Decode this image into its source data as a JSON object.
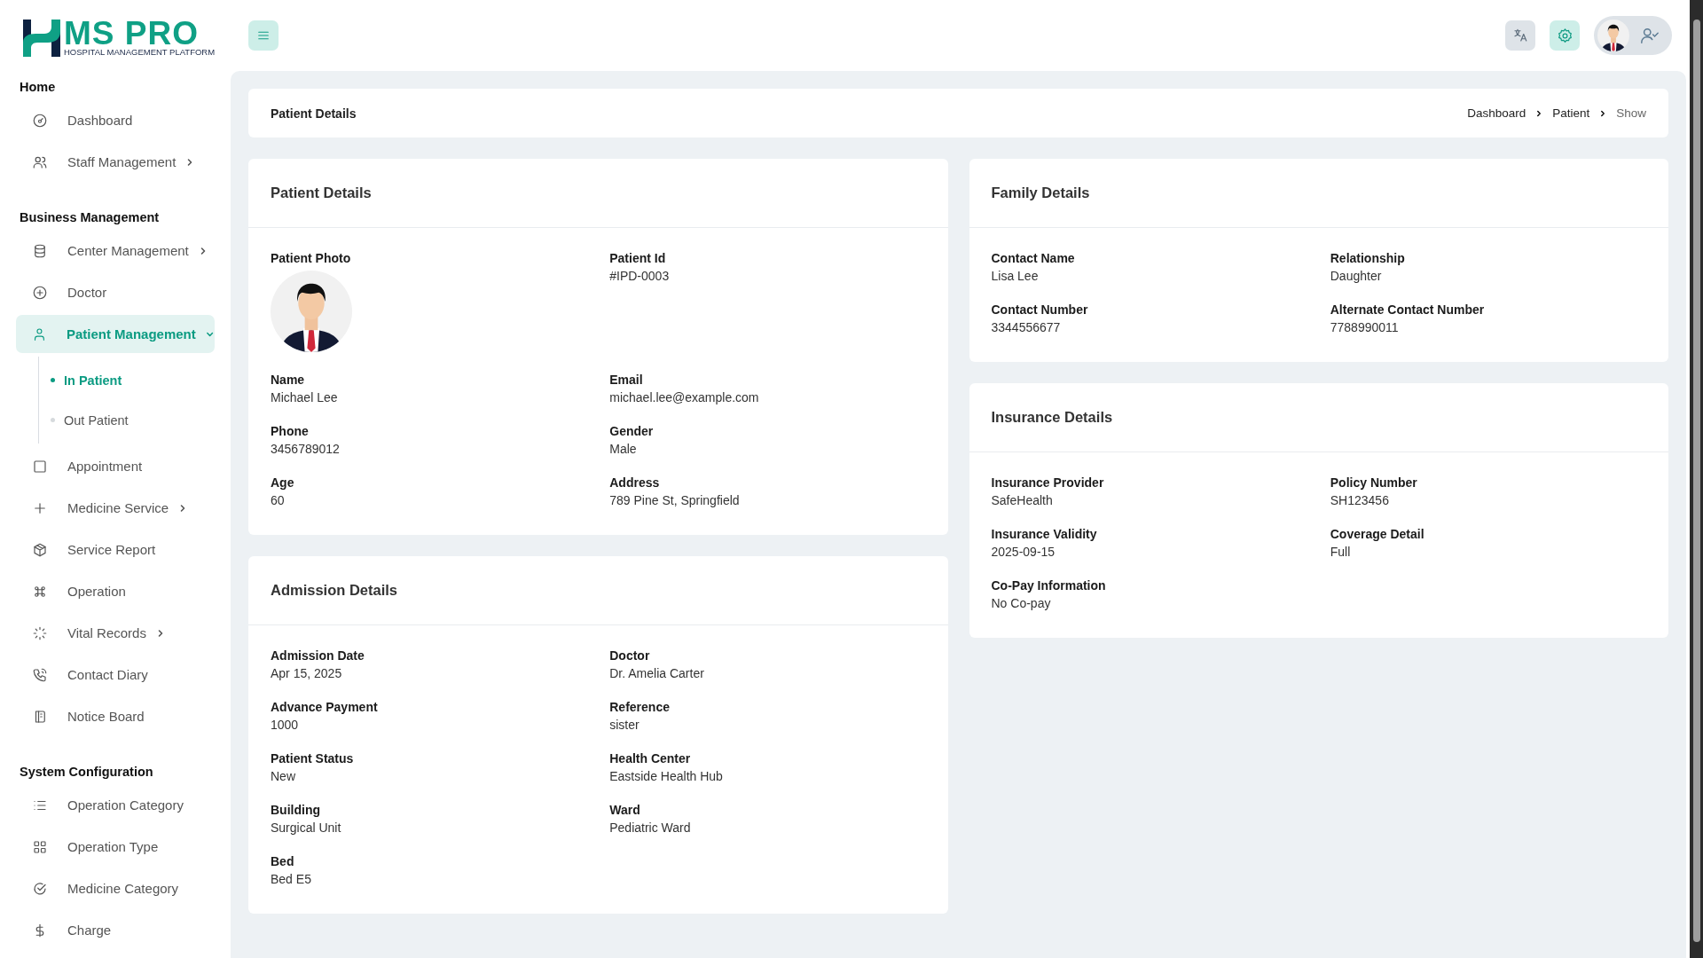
{
  "logo": {
    "title": "MS PRO",
    "subtitle": "HOSPITAL MANAGEMENT PLATFORM"
  },
  "sidebar": {
    "sections": [
      {
        "title": "Home",
        "items": [
          {
            "label": "Dashboard",
            "selected": false
          },
          {
            "label": "Staff Management",
            "expanded": false,
            "selected": false
          }
        ]
      },
      {
        "title": "Business Management",
        "items": [
          {
            "label": "Center Management",
            "expanded": false,
            "selected": false
          },
          {
            "label": "Doctor",
            "selected": false
          },
          {
            "label": "Patient Management",
            "expanded": true,
            "selected": true,
            "children": [
              {
                "label": "In Patient",
                "selected": true
              },
              {
                "label": "Out Patient",
                "selected": false
              }
            ]
          },
          {
            "label": "Appointment",
            "selected": false
          },
          {
            "label": "Medicine Service",
            "expanded": false,
            "selected": false
          },
          {
            "label": "Service Report",
            "selected": false
          },
          {
            "label": "Operation",
            "selected": false
          },
          {
            "label": "Vital Records",
            "expanded": false,
            "selected": false
          },
          {
            "label": "Contact Diary",
            "selected": false
          },
          {
            "label": "Notice Board",
            "selected": false
          }
        ]
      },
      {
        "title": "System Configuration",
        "items": [
          {
            "label": "Operation Category",
            "selected": false
          },
          {
            "label": "Operation Type",
            "selected": false
          },
          {
            "label": "Medicine Category",
            "selected": false
          },
          {
            "label": "Charge",
            "selected": false
          }
        ]
      }
    ]
  },
  "page_header": {
    "title": "Patient Details",
    "breadcrumb": [
      "Dashboard",
      "Patient",
      "Show"
    ]
  },
  "cards": [
    {
      "title": "Patient Details",
      "fields": [
        {
          "kind": "photo",
          "label": "Patient Photo"
        },
        {
          "kind": "text",
          "label": "Patient Id",
          "value": "#IPD-0003"
        },
        {
          "kind": "text",
          "label": "Name",
          "value": "Michael Lee"
        },
        {
          "kind": "text",
          "label": "Email",
          "value": "michael.lee@example.com"
        },
        {
          "kind": "text",
          "label": "Phone",
          "value": "3456789012"
        },
        {
          "kind": "text",
          "label": "Gender",
          "value": "Male"
        },
        {
          "kind": "text",
          "label": "Age",
          "value": "60"
        },
        {
          "kind": "text",
          "label": "Address",
          "value": "789 Pine St, Springfield"
        }
      ]
    },
    {
      "title": "Admission Details",
      "fields": [
        {
          "kind": "text",
          "label": "Admission Date",
          "value": "Apr 15, 2025"
        },
        {
          "kind": "text",
          "label": "Doctor",
          "value": "Dr. Amelia Carter"
        },
        {
          "kind": "text",
          "label": "Advance Payment",
          "value": "1000"
        },
        {
          "kind": "text",
          "label": "Reference",
          "value": "sister"
        },
        {
          "kind": "text",
          "label": "Patient Status",
          "value": "New"
        },
        {
          "kind": "text",
          "label": "Health Center",
          "value": "Eastside Health Hub"
        },
        {
          "kind": "text",
          "label": "Building",
          "value": "Surgical Unit"
        },
        {
          "kind": "text",
          "label": "Ward",
          "value": "Pediatric Ward"
        },
        {
          "kind": "text",
          "label": "Bed",
          "value": "Bed E5"
        }
      ]
    },
    {
      "title": "Family Details",
      "fields": [
        {
          "kind": "text",
          "label": "Contact Name",
          "value": "Lisa Lee"
        },
        {
          "kind": "text",
          "label": "Relationship",
          "value": "Daughter"
        },
        {
          "kind": "text",
          "label": "Contact Number",
          "value": "3344556677"
        },
        {
          "kind": "text",
          "label": "Alternate Contact Number",
          "value": "7788990011"
        }
      ]
    },
    {
      "title": "Insurance Details",
      "fields": [
        {
          "kind": "text",
          "label": "Insurance Provider",
          "value": "SafeHealth"
        },
        {
          "kind": "text",
          "label": "Policy Number",
          "value": "SH123456"
        },
        {
          "kind": "text",
          "label": "Insurance Validity",
          "value": "2025-09-15"
        },
        {
          "kind": "text",
          "label": "Coverage Detail",
          "value": "Full"
        },
        {
          "kind": "text",
          "label": "Co-Pay Information",
          "value": "No Co-pay"
        }
      ]
    }
  ]
}
